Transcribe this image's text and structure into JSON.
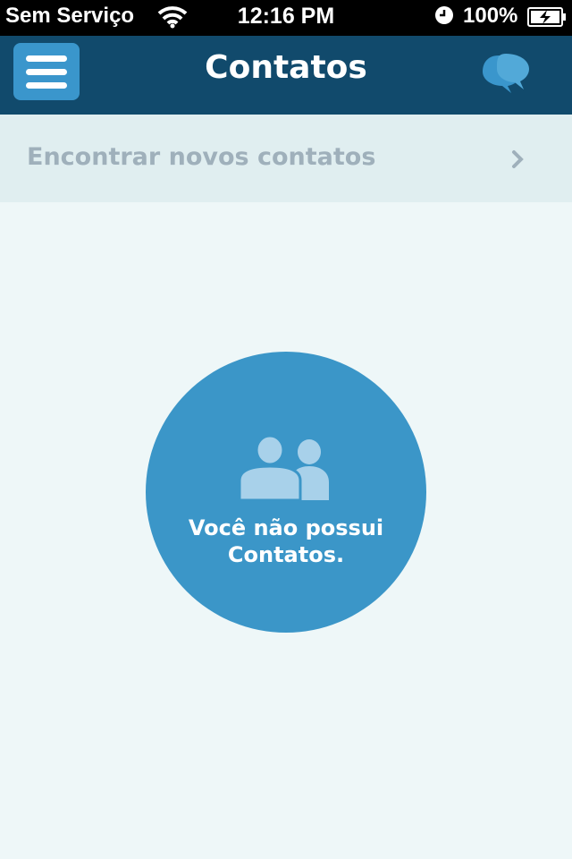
{
  "status_bar": {
    "carrier": "Sem Serviço",
    "time": "12:16 PM",
    "battery": "100%",
    "icons": [
      "wifi-icon",
      "clock-icon",
      "battery-charging-icon"
    ]
  },
  "nav": {
    "title": "Contatos",
    "menu_icon": "hamburger-menu-icon",
    "chat_icon": "chat-bubbles-icon"
  },
  "find_contacts": {
    "label": "Encontrar novos contatos",
    "icon": "chevron-right-icon"
  },
  "empty_state": {
    "line1": "Você não possui",
    "line2": "Contatos.",
    "icon": "people-icon"
  },
  "colors": {
    "nav_bg": "#114a6c",
    "accent": "#3a96cc",
    "page_bg": "#eef7f8",
    "row_bg": "#e0eef0",
    "muted_text": "#9fb0bb"
  }
}
